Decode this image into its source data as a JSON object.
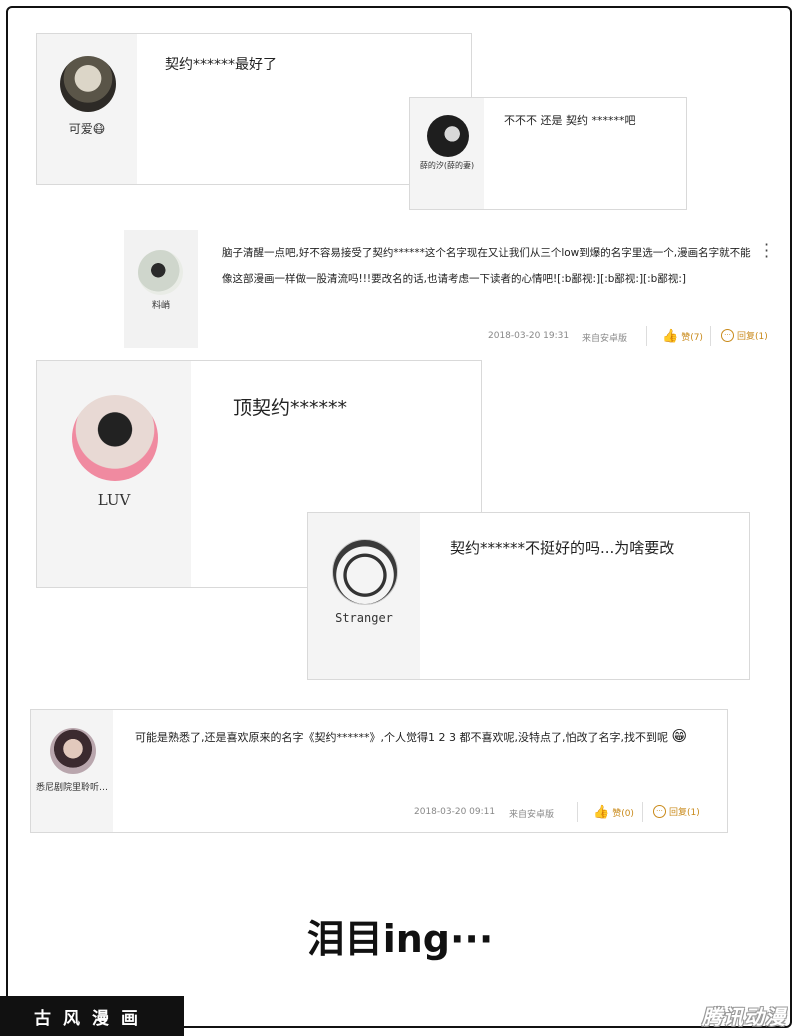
{
  "comments": [
    {
      "user": "可爱😷",
      "text": "契约******最好了"
    },
    {
      "user": "薛的汐(薛的妻)",
      "text": "不不不 还是 契约 ******吧"
    },
    {
      "user": "料峭",
      "text": "脑子清醒一点吧,好不容易接受了契约******这个名字现在又让我们从三个low到爆的名字里选一个,漫画名字就不能像这部漫画一样做一股清流吗!!!要改名的话,也请考虑一下读者的心情吧![:b鄙视:][:b鄙视:][:b鄙视:]",
      "time": "2018-03-20 19:31",
      "source": "来自安卓版",
      "like": "赞(7)",
      "reply": "回复(1)"
    },
    {
      "user": "LUV",
      "text": "顶契约******"
    },
    {
      "user": "Stranger",
      "text": "契约******不挺好的吗...为啥要改"
    },
    {
      "user": "悉尼剧院里聆听…",
      "text": "可能是熟悉了,还是喜欢原来的名字《契约******》,个人觉得1 2 3 都不喜欢呢,没特点了,怕改了名字,找不到呢",
      "time": "2018-03-20 09:11",
      "source": "来自安卓版",
      "like": "赞(0)",
      "reply": "回复(1)"
    }
  ],
  "more_icon": "more-vertical-icon",
  "caption": "泪目ing···",
  "watermark_left": "古风漫画",
  "watermark_right": "腾讯动漫",
  "colors": {
    "action": "#c98a1a",
    "sidebar": "#f4f4f4",
    "border": "#d9d9d9"
  }
}
